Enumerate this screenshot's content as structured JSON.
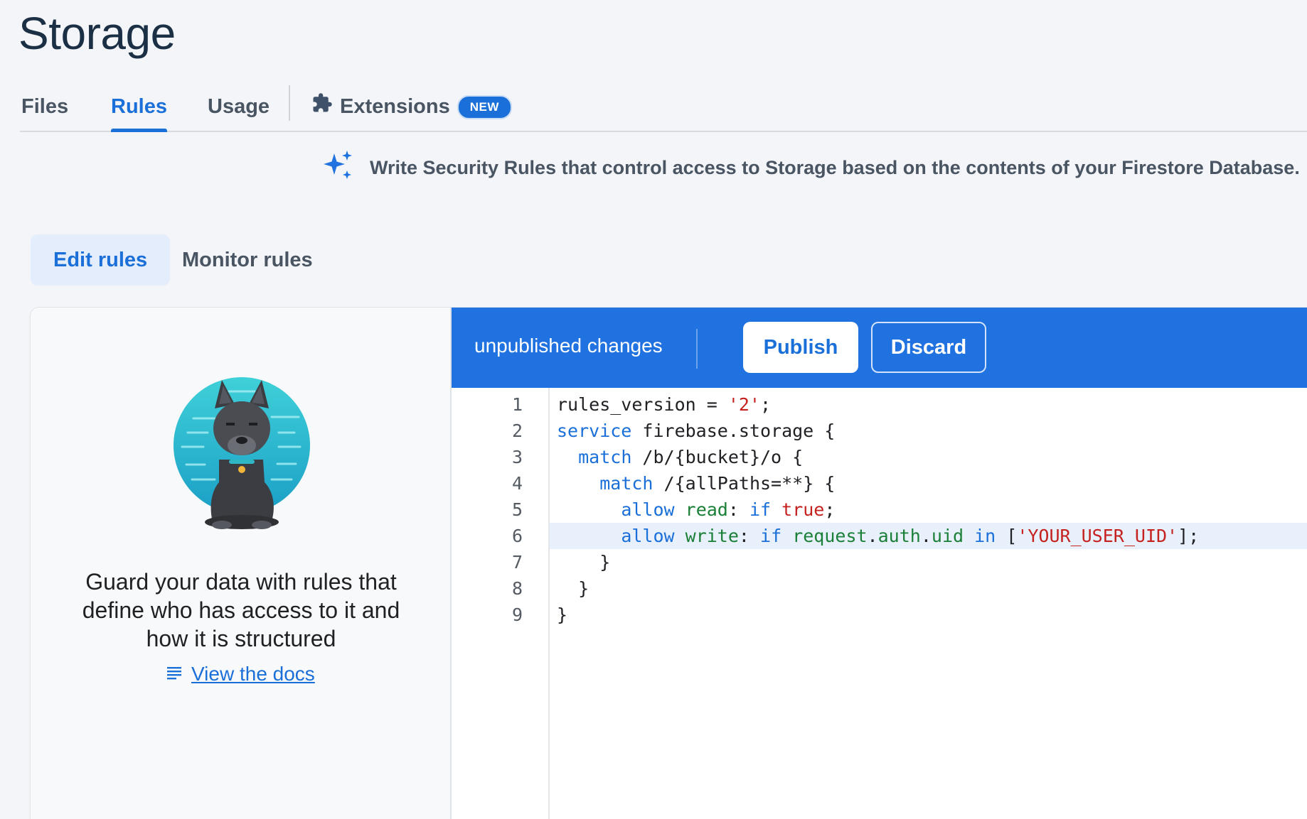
{
  "page": {
    "title": "Storage"
  },
  "tabs": [
    {
      "label": "Files",
      "active": false
    },
    {
      "label": "Rules",
      "active": true
    },
    {
      "label": "Usage",
      "active": false
    },
    {
      "label": "Extensions",
      "active": false,
      "badge": "NEW",
      "icon": "puzzle-icon"
    }
  ],
  "banner": {
    "icon": "sparkle-icon",
    "text": "Write Security Rules that control access to Storage based on the contents of your Firestore Database."
  },
  "subtabs": [
    {
      "label": "Edit rules",
      "active": true
    },
    {
      "label": "Monitor rules",
      "active": false
    }
  ],
  "left_panel": {
    "illustration": "dog-illustration",
    "text": "Guard your data with rules that define who has access to it and how it is structured",
    "docs_link": "View the docs",
    "docs_icon": "notes-icon"
  },
  "editor_bar": {
    "status": "unpublished changes",
    "publish_label": "Publish",
    "discard_label": "Discard"
  },
  "editor": {
    "current_line": 6,
    "lines": [
      {
        "num": "1",
        "text": "rules_version = '2';"
      },
      {
        "num": "2",
        "text": "service firebase.storage {"
      },
      {
        "num": "3",
        "text": "  match /b/{bucket}/o {"
      },
      {
        "num": "4",
        "text": "    match /{allPaths=**} {"
      },
      {
        "num": "5",
        "text": "      allow read: if true;"
      },
      {
        "num": "6",
        "text": "      allow write: if request.auth.uid in ['YOUR_USER_UID'];"
      },
      {
        "num": "7",
        "text": "    }"
      },
      {
        "num": "8",
        "text": "  }"
      },
      {
        "num": "9",
        "text": "}"
      }
    ]
  },
  "colors": {
    "accent": "#1a6fd8",
    "editor_bar": "#1f72e0",
    "keyword": "#1a6fd8",
    "identifier": "#1a7f37",
    "string": "#c5221f"
  }
}
